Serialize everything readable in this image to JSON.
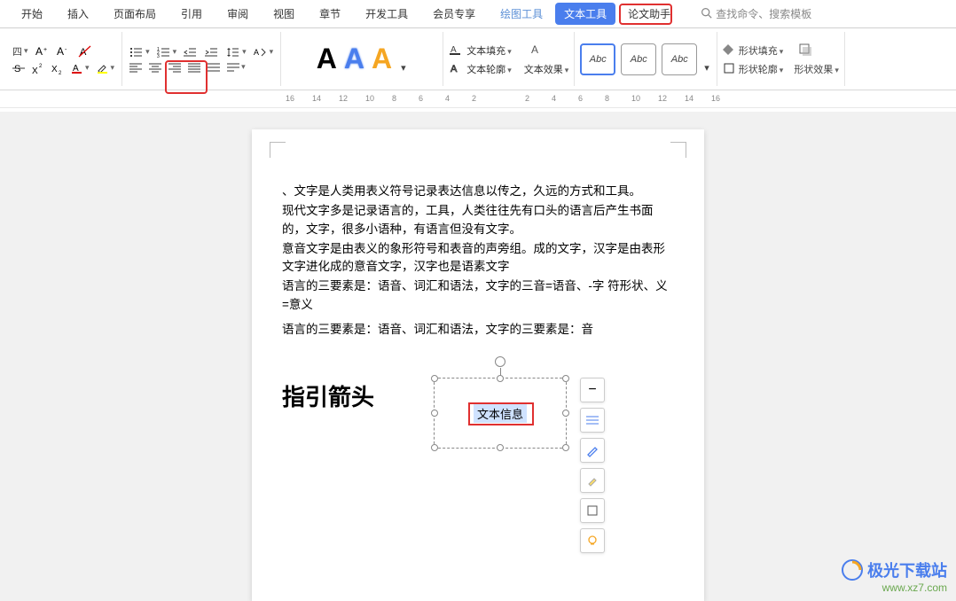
{
  "tabs": {
    "items": [
      "开始",
      "插入",
      "页面布局",
      "引用",
      "审阅",
      "视图",
      "章节",
      "开发工具",
      "会员专享",
      "绘图工具",
      "文本工具",
      "论文助手"
    ],
    "active_index": 10,
    "search_placeholder": "查找命令、搜索模板"
  },
  "ribbon": {
    "format_dropdown": "四",
    "text_fill": "文本填充",
    "text_outline": "文本轮廓",
    "text_effect": "文本效果",
    "abc": [
      "Abc",
      "Abc",
      "Abc"
    ],
    "shape_fill": "形状填充",
    "shape_outline": "形状轮廓",
    "shape_effect": "形状效果"
  },
  "ruler_marks": [
    16,
    14,
    12,
    10,
    8,
    6,
    4,
    2,
    2,
    4,
    6,
    8,
    10,
    12,
    14,
    16
  ],
  "document": {
    "paragraphs": [
      "、文字是人类用表义符号记录表达信息以传之，久远的方式和工具。",
      "现代文字多是记录语言的，工具，人类往往先有口头的语言后产生书面的，文字，很多小语种，有语言但没有文字。",
      "意音文字是由表义的象形符号和表音的声旁组。成的文字，汉字是由表形文字进化成的意音文字，汉字也是语素文字",
      "语言的三要素是：语音、词汇和语法，文字的三音=语音、-字 符形状、义=意义",
      "语言的三要素是：语音、词汇和语法，文字的三要素是：音"
    ],
    "heading": "指引箭头",
    "textbox_content": "文本信息"
  },
  "watermark": {
    "logo": "极光下载站",
    "url": "www.xz7.com"
  }
}
